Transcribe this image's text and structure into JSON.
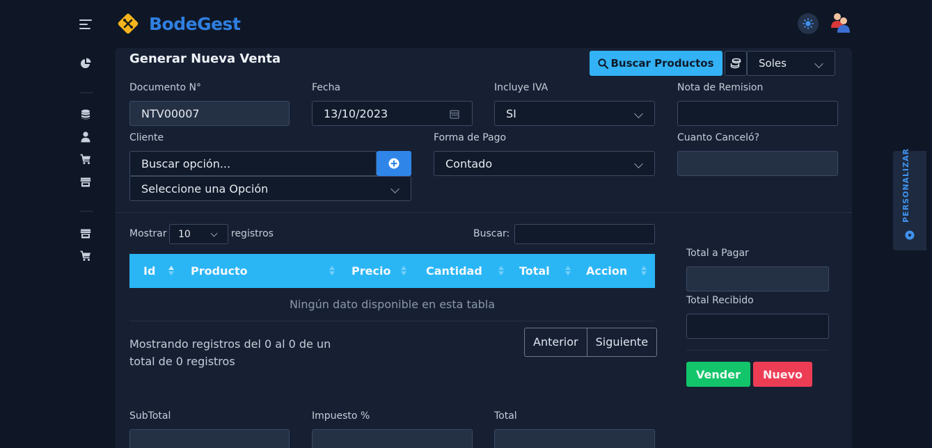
{
  "app": {
    "name": "BodeGest"
  },
  "sidebar": {
    "items": [
      {
        "name": "dashboard",
        "icon": "pie-chart-icon"
      },
      {
        "name": "database",
        "icon": "database-icon"
      },
      {
        "name": "users",
        "icon": "user-icon"
      },
      {
        "name": "sales",
        "icon": "cart-icon"
      },
      {
        "name": "store",
        "icon": "store-icon"
      },
      {
        "name": "store-2",
        "icon": "store-icon"
      },
      {
        "name": "cart-2",
        "icon": "cart-icon"
      }
    ]
  },
  "card": {
    "title": "Generar Nueva Venta",
    "search_products_label": "Buscar Productos",
    "currency": {
      "selected": "Soles"
    }
  },
  "form": {
    "documento": {
      "label": "Documento N°",
      "value": "NTV00007"
    },
    "fecha": {
      "label": "Fecha",
      "value": "13/10/2023"
    },
    "iva": {
      "label": "Incluye IVA",
      "value": "SI"
    },
    "nota": {
      "label": "Nota de Remision",
      "value": ""
    },
    "cliente": {
      "label": "Cliente",
      "placeholder": "Buscar opción...",
      "select_value": "Seleccione una Opción"
    },
    "forma_pago": {
      "label": "Forma de Pago",
      "value": "Contado"
    },
    "cancelo": {
      "label": "Cuanto Canceló?",
      "value": ""
    }
  },
  "table": {
    "show_label": "Mostrar",
    "show_value": "10",
    "records_label": "registros",
    "search_label": "Buscar:",
    "columns": [
      "Id",
      "Producto",
      "Precio",
      "Cantidad",
      "Total",
      "Accion"
    ],
    "empty_text": "Ningún dato disponible en esta tabla",
    "info_text": "Mostrando registros del 0 al 0 de un total de 0 registros",
    "prev_label": "Anterior",
    "next_label": "Siguiente"
  },
  "payment": {
    "total_pagar_label": "Total a Pagar",
    "total_recibido_label": "Total Recibido",
    "sell_label": "Vender",
    "new_label": "Nuevo"
  },
  "totals": {
    "subtotal_label": "SubTotal",
    "impuesto_label": "Impuesto %",
    "total_label": "Total"
  },
  "personalize": {
    "label": "PERSONALIZAR"
  },
  "colors": {
    "accent": "#33b2f5",
    "brand": "#2f7fe0",
    "success": "#12c46a",
    "danger": "#ec3d55"
  }
}
